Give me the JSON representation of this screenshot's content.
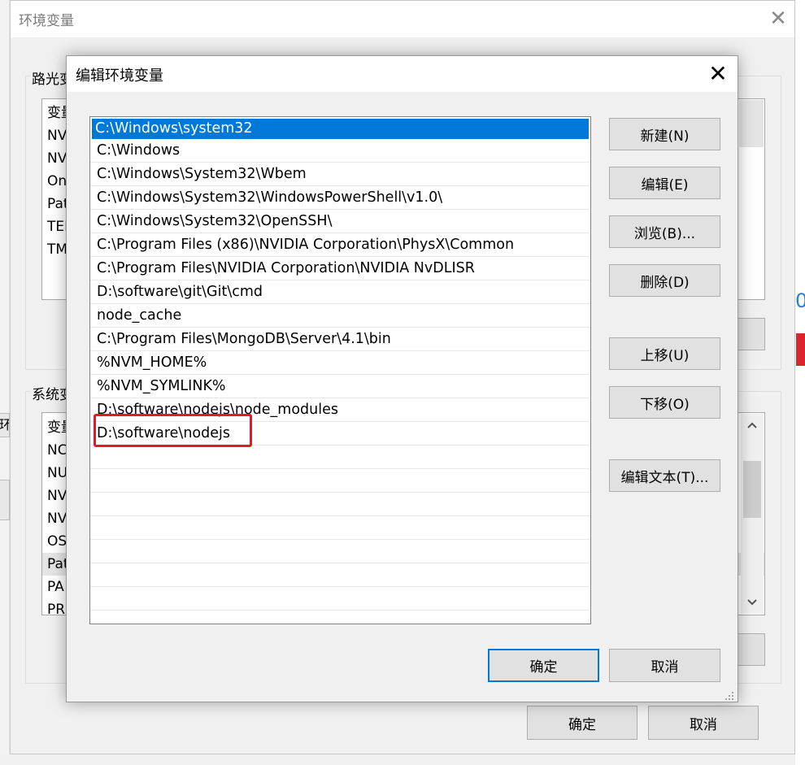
{
  "parent_window": {
    "title": "环境变量",
    "close_glyph": "✕",
    "user_group_label": "路光变",
    "user_var_header": "变量",
    "user_vars": [
      "NV",
      "NV",
      "On",
      "Pat",
      "TEI",
      "TM"
    ],
    "system_group_label": "系统变",
    "system_var_header": "变量",
    "system_vars": [
      "NC",
      "NU",
      "NV",
      "NV",
      "OS",
      "Pat",
      "PA",
      "PR"
    ],
    "ok_label": "确定",
    "cancel_label": "取消",
    "left_edge_text": "环",
    "right_edge_fragment": "0"
  },
  "dialog": {
    "title": "编辑环境变量",
    "close_glyph": "✕",
    "paths": [
      "C:\\Windows\\system32",
      "C:\\Windows",
      "C:\\Windows\\System32\\Wbem",
      "C:\\Windows\\System32\\WindowsPowerShell\\v1.0\\",
      "C:\\Windows\\System32\\OpenSSH\\",
      "C:\\Program Files (x86)\\NVIDIA Corporation\\PhysX\\Common",
      "C:\\Program Files\\NVIDIA Corporation\\NVIDIA NvDLISR",
      "D:\\software\\git\\Git\\cmd",
      "node_cache",
      "C:\\Program Files\\MongoDB\\Server\\4.1\\bin",
      "%NVM_HOME%",
      "%NVM_SYMLINK%",
      "D:\\software\\nodejs\\node_modules",
      "D:\\software\\nodejs"
    ],
    "buttons": {
      "new": "新建(N)",
      "edit": "编辑(E)",
      "browse": "浏览(B)...",
      "delete": "删除(D)",
      "move_up": "上移(U)",
      "move_down": "下移(O)",
      "edit_text": "编辑文本(T)..."
    },
    "ok_label": "确定",
    "cancel_label": "取消"
  },
  "colors": {
    "selection": "#0078d7",
    "highlight_border": "#e31d1d",
    "dialog_bg": "#f0f0f0"
  }
}
